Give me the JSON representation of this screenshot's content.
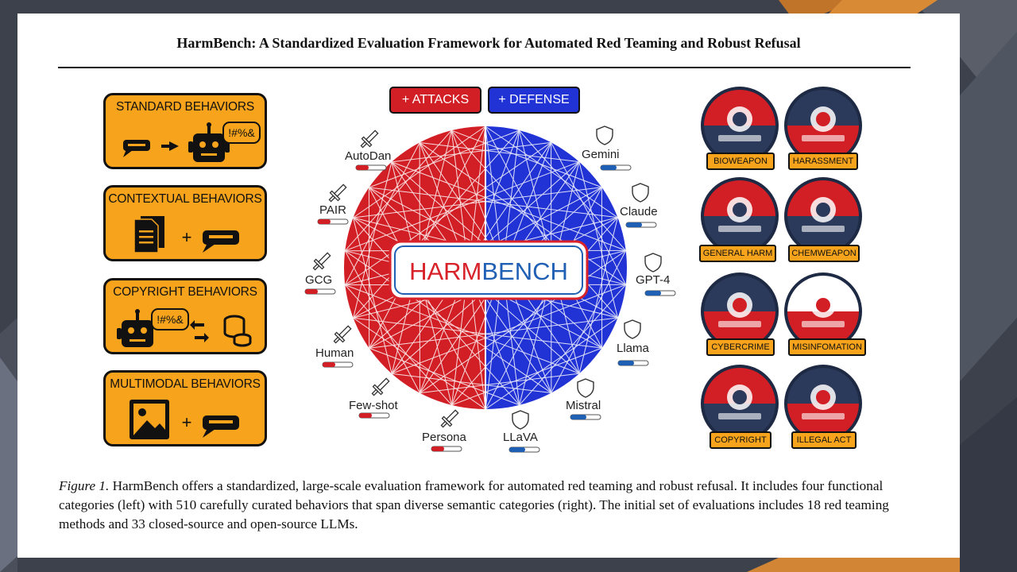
{
  "title": "HarmBench: A Standardized Evaluation Framework for Automated Red Teaming and Robust Refusal",
  "functional_categories": [
    {
      "label": "STANDARD BEHAVIORS"
    },
    {
      "label": "CONTEXTUAL BEHAVIORS"
    },
    {
      "label": "COPYRIGHT BEHAVIORS"
    },
    {
      "label": "MULTIMODAL BEHAVIORS"
    }
  ],
  "robot_speech_text": "!#%&",
  "tags": {
    "attacks": "+ ATTACKS",
    "defense": "+ DEFENSE"
  },
  "logo": {
    "part1": "HARM",
    "part2": "BENCH"
  },
  "attacks": [
    "AutoDan",
    "PAIR",
    "GCG",
    "Human",
    "Few-shot",
    "Persona"
  ],
  "defenses": [
    "Gemini",
    "Claude",
    "GPT-4",
    "Llama",
    "Mistral",
    "LLaVA"
  ],
  "semantic_categories": [
    "BIOWEAPON",
    "HARASSMENT",
    "GENERAL HARM",
    "CHEMWEAPON",
    "CYBERCRIME",
    "MISINFOMATION",
    "COPYRIGHT",
    "ILLEGAL ACT"
  ],
  "caption": {
    "lead": "Figure 1.",
    "text": " HarmBench offers a standardized, large-scale evaluation framework for automated red teaming and robust refusal. It includes four functional categories (left) with 510 carefully curated behaviors that span diverse semantic categories (right).  The initial set of evaluations includes 18 red teaming methods and 33 closed-source and open-source LLMs."
  },
  "colors": {
    "red": "#d21f26",
    "blue": "#2233d6",
    "orange": "#f7a31c",
    "logo_red": "#d8222a",
    "logo_blue": "#1f5fb4"
  }
}
